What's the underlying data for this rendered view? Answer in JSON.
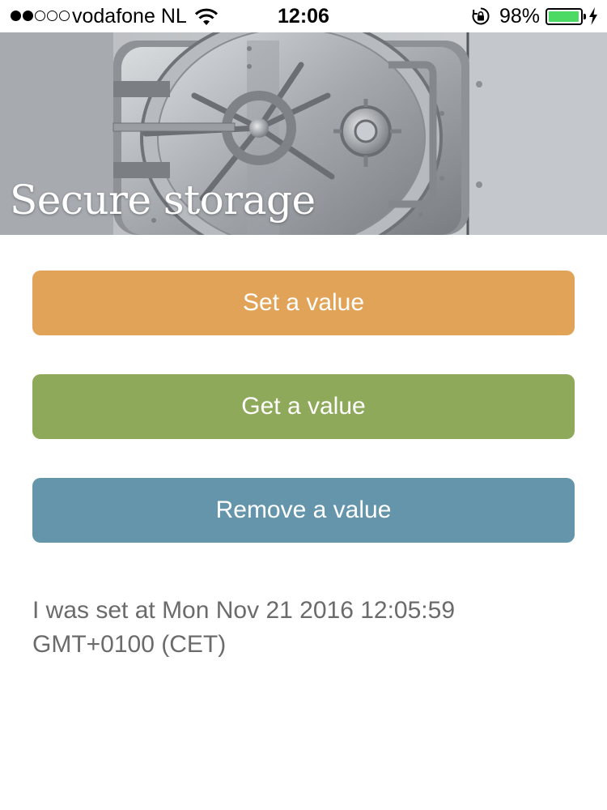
{
  "status_bar": {
    "signal_bars_filled": 2,
    "signal_bars_total": 5,
    "carrier": "vodafone NL",
    "time": "12:06",
    "battery_percent": "98%",
    "battery_level": 0.98,
    "icons": [
      "wifi-icon",
      "rotation-lock-icon",
      "battery-icon",
      "charging-bolt-icon"
    ]
  },
  "hero": {
    "title": "Secure storage"
  },
  "buttons": {
    "set": {
      "label": "Set a value",
      "color": "#e1a357"
    },
    "get": {
      "label": "Get a value",
      "color": "#8fa95a"
    },
    "remove": {
      "label": "Remove a value",
      "color": "#6495aa"
    }
  },
  "result_text": "I was set at Mon Nov 21 2016 12:05:59 GMT+0100 (CET)"
}
